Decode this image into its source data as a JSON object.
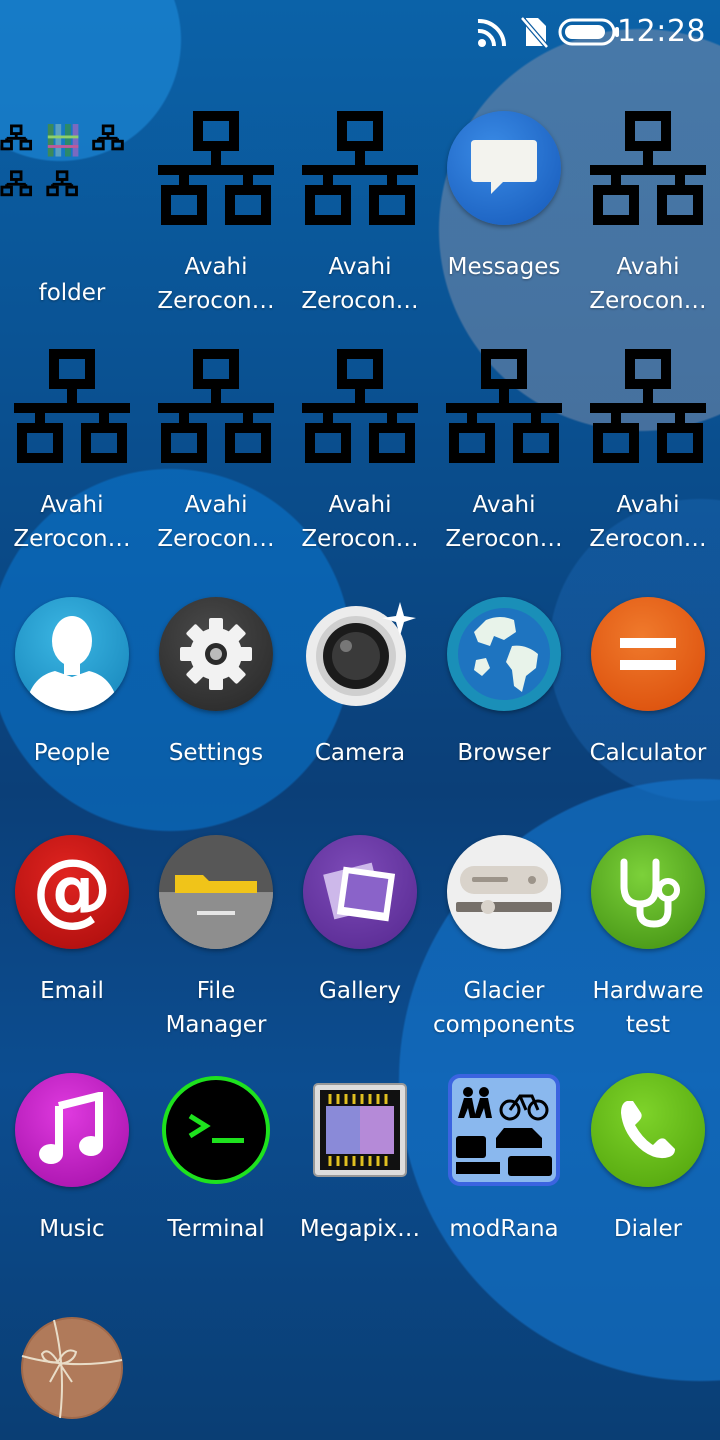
{
  "status_bar": {
    "time": "12:28",
    "icons": [
      "wifi-signal-icon",
      "no-sim-icon",
      "battery-icon"
    ]
  },
  "launcher": {
    "rows": [
      [
        {
          "label": "folder",
          "icon": "folder-icon"
        },
        {
          "label": "Avahi Zerocon…",
          "icon": "network-icon"
        },
        {
          "label": "Avahi Zerocon…",
          "icon": "network-icon"
        },
        {
          "label": "Messages",
          "icon": "messages-icon"
        },
        {
          "label": "Avahi Zerocon…",
          "icon": "network-icon"
        }
      ],
      [
        {
          "label": "Avahi Zerocon…",
          "icon": "network-icon"
        },
        {
          "label": "Avahi Zerocon…",
          "icon": "network-icon"
        },
        {
          "label": "Avahi Zerocon…",
          "icon": "network-icon"
        },
        {
          "label": "Avahi Zerocon…",
          "icon": "network-icon"
        },
        {
          "label": "Avahi Zerocon…",
          "icon": "network-icon"
        }
      ],
      [
        {
          "label": "People",
          "icon": "people-icon"
        },
        {
          "label": "Settings",
          "icon": "settings-gear-icon"
        },
        {
          "label": "Camera",
          "icon": "camera-icon"
        },
        {
          "label": "Browser",
          "icon": "globe-icon"
        },
        {
          "label": "Calculator",
          "icon": "calculator-icon"
        }
      ],
      [
        {
          "label": "Email",
          "icon": "email-at-icon"
        },
        {
          "label": "File Manager",
          "icon": "file-manager-icon"
        },
        {
          "label": "Gallery",
          "icon": "gallery-icon"
        },
        {
          "label": "Glacier components",
          "icon": "glacier-components-icon"
        },
        {
          "label": "Hardware test",
          "icon": "stethoscope-icon"
        }
      ],
      [
        {
          "label": "Music",
          "icon": "music-note-icon"
        },
        {
          "label": "Terminal",
          "icon": "terminal-icon"
        },
        {
          "label": "Megapix…",
          "icon": "megapixels-icon"
        },
        {
          "label": "modRana",
          "icon": "modrana-icon"
        },
        {
          "label": "Dialer",
          "icon": "phone-icon"
        }
      ],
      [
        {
          "label": "",
          "icon": "package-icon"
        }
      ]
    ]
  },
  "colors": {
    "messages": "#1e6fcf",
    "people": "#1b93c9",
    "settings": "#3a3a3a",
    "browser": "#1a88b5",
    "calculator": "#e55a12",
    "email": "#c4120f",
    "gallery": "#6a3aa3",
    "hardware": "#5aa81a",
    "music": "#c21cc4",
    "dialer": "#66b512",
    "terminal_accent": "#1ee21e"
  }
}
